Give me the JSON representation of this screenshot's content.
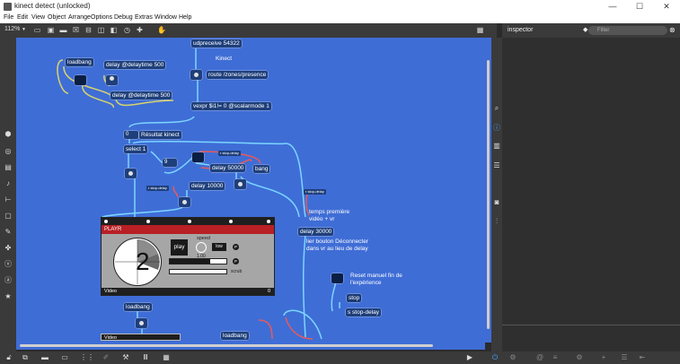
{
  "window": {
    "title": "kinect detect (unlocked)",
    "minimize": "—",
    "maximize": "☐",
    "close": "✕"
  },
  "menu": [
    "File",
    "Edit",
    "View",
    "Object",
    "Arrange",
    "Options",
    "Debug",
    "Extras",
    "Window",
    "Help"
  ],
  "toolbar": {
    "zoom": "112%"
  },
  "inspector": {
    "title": "inspector",
    "filter_placeholder": "Filter"
  },
  "patch": {
    "udpreceive": "udpreceive 54322",
    "kinect_comment": "Kinect",
    "route": "route /zones/presence",
    "loadbang1": "loadbang",
    "delay1": "delay @delaytime 500",
    "delay2": "delay @delaytime 500",
    "vexpr": "vexpr $i1!= 0 @scalarmode 1",
    "num_zero": "0",
    "resultat_comment": "Résultat kinect",
    "select": "select 1",
    "num_nine": "9",
    "r_stop_delay1": "r stop-delay",
    "delay_50000": "delay 50000",
    "bang": "bang",
    "r_stop_delay2": "r stop-delay",
    "delay_10000": "delay 10000",
    "r_stop_delay3": "r stop-delay",
    "temps_comment": "temps première vidéo + vr",
    "delay_30000": "delay 30000",
    "lier_comment": "lier bouton Déconnecter dans vr au lieu de delay",
    "reset_comment": "Reset manuel fin de l'expérience",
    "stop": "stop",
    "s_stop_delay": "s stop-delay",
    "loadbang2": "loadbang",
    "loadbang3": "loadbang",
    "video_label2": "Video"
  },
  "playr": {
    "title": "PLAYR",
    "counter": "2",
    "play": "play",
    "speed_label": "speed",
    "speed_value": "1.00",
    "low": "low",
    "p1": "P",
    "p2": "P",
    "scrub": "scrub",
    "video": "Video",
    "footer_right": "0",
    "slider_fill": 0.72
  },
  "colors": {
    "canvas": "#3f6dd6",
    "accent_blue": "#1e3f7a",
    "playr_red": "#b82025"
  }
}
